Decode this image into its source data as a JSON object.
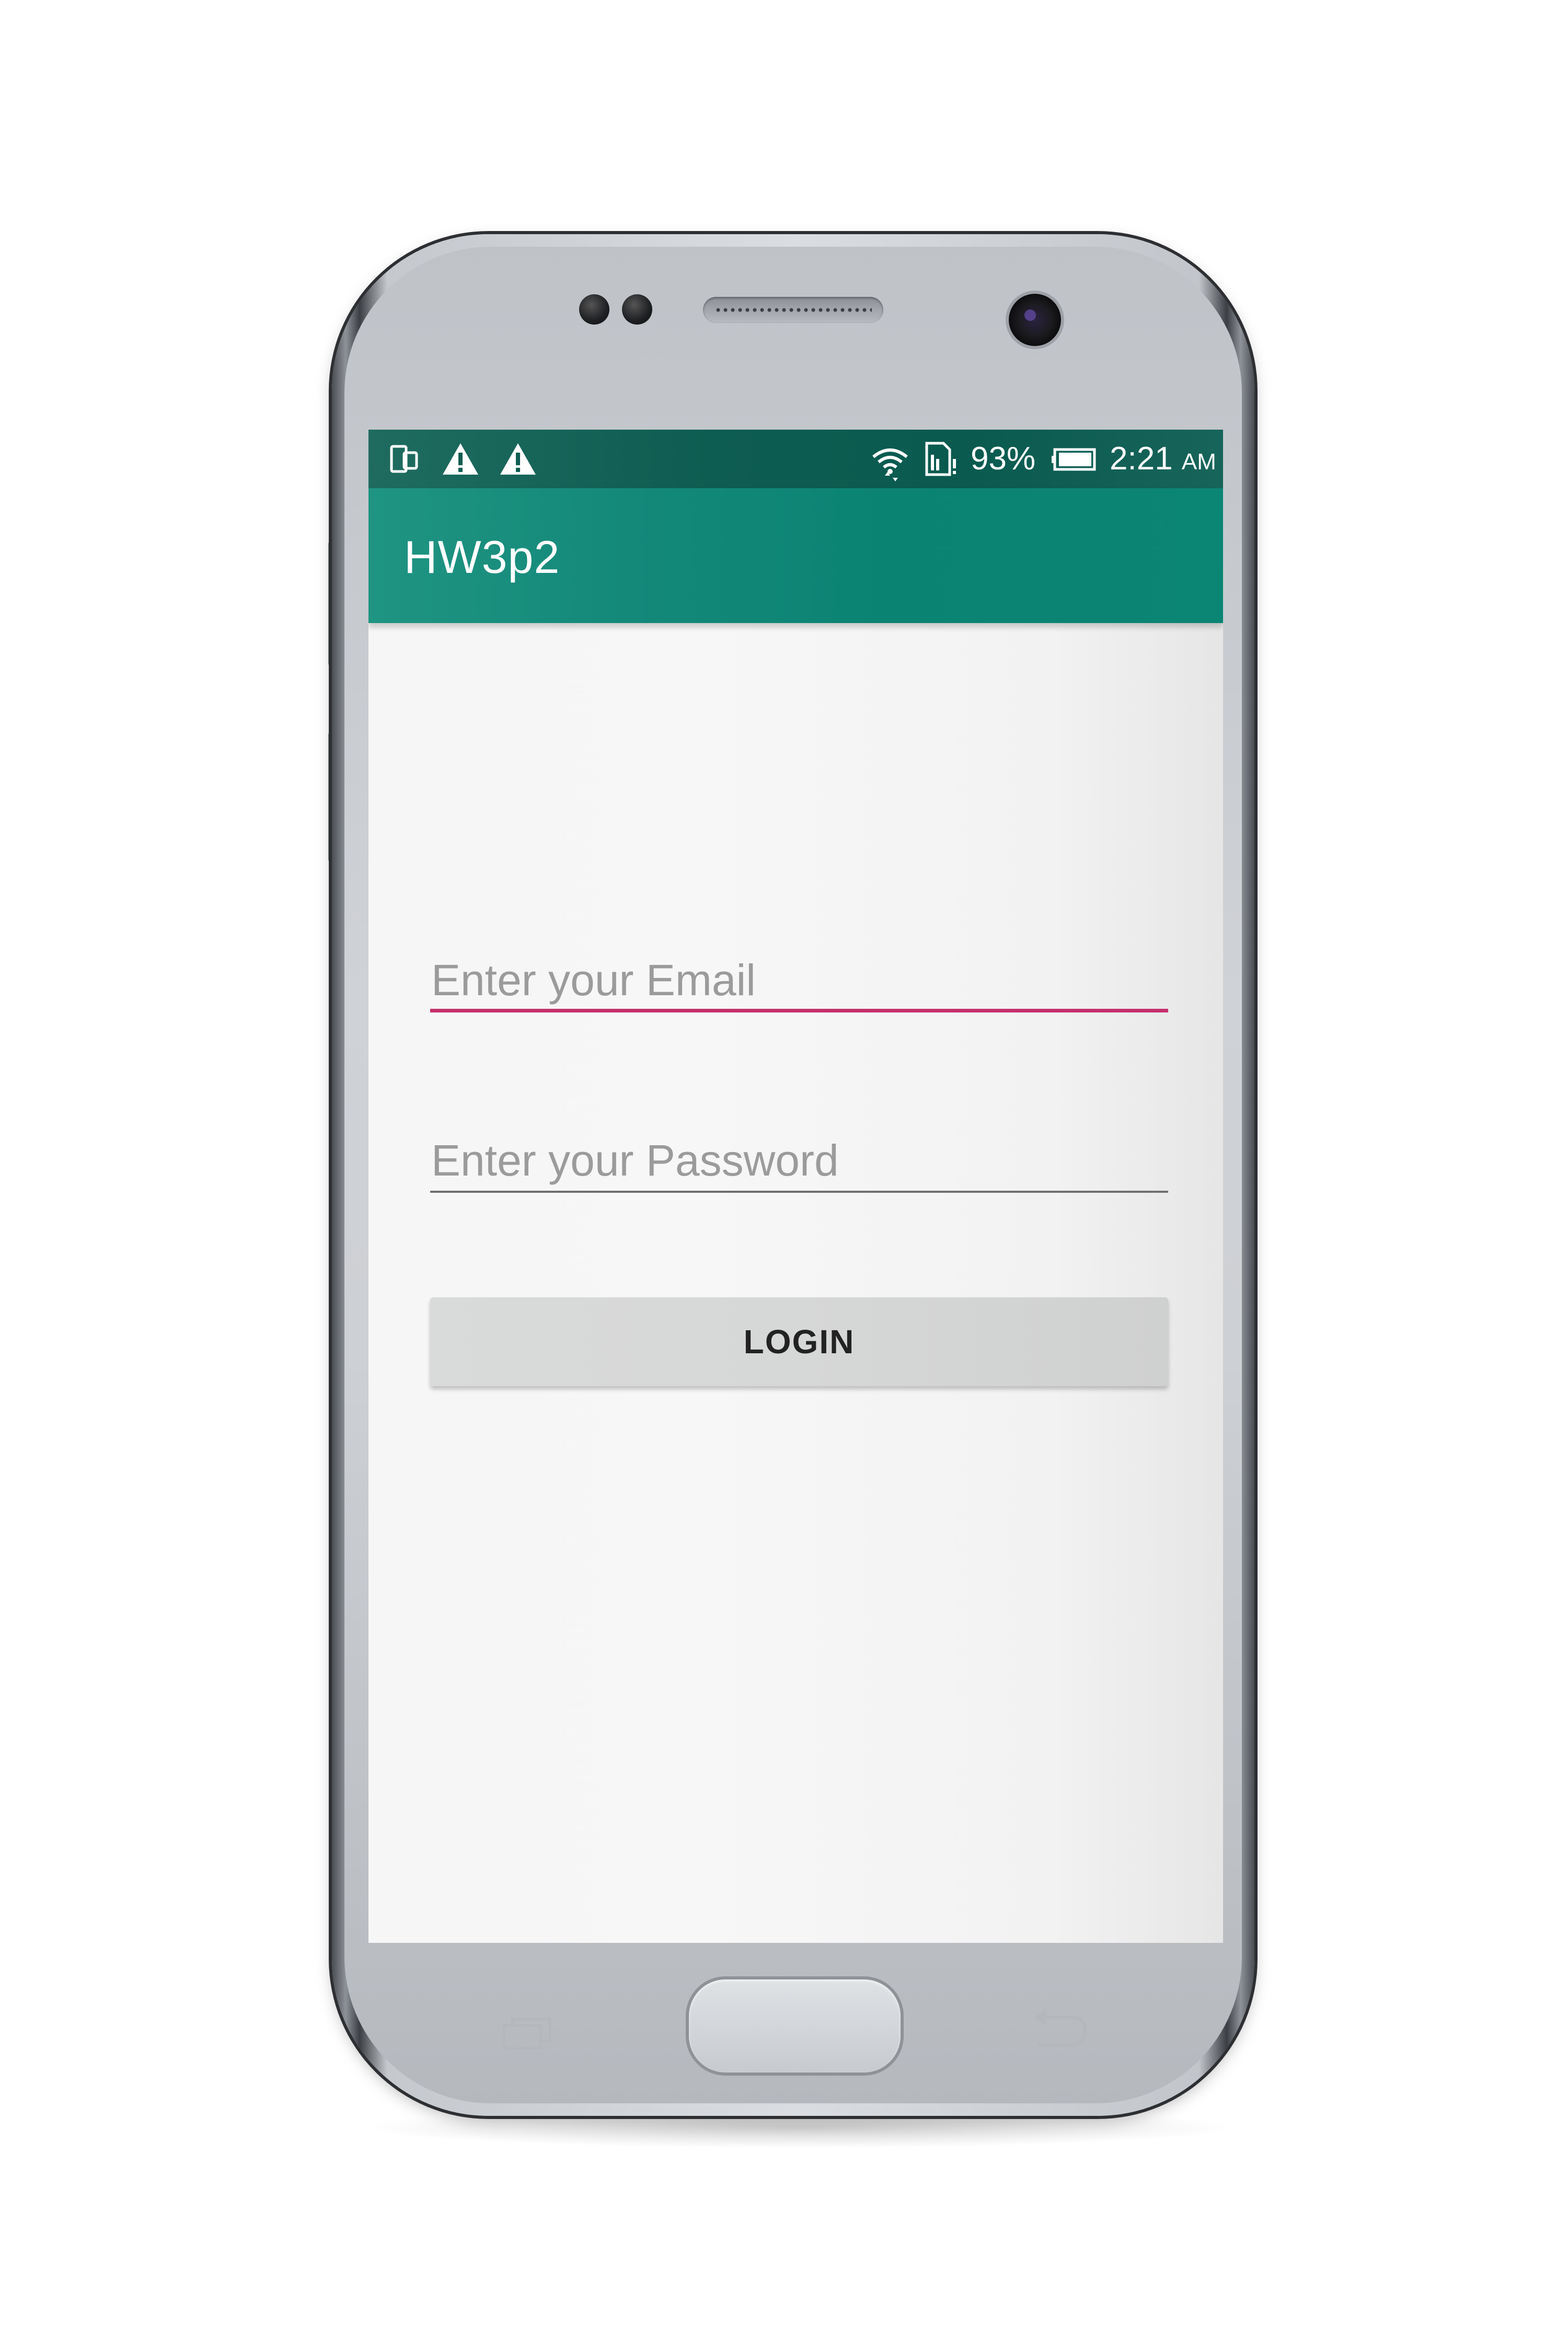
{
  "status_bar": {
    "icons": [
      "screen-rotate-icon",
      "warning-icon",
      "warning-icon",
      "wifi-icon",
      "sim-card-icon",
      "battery-icon"
    ],
    "battery_percent": "93%",
    "time": "2:21",
    "ampm": "AM"
  },
  "app_bar": {
    "title": "HW3p2"
  },
  "form": {
    "email_placeholder": "Enter your Email",
    "password_placeholder": "Enter your Password",
    "login_label": "LOGIN"
  },
  "colors": {
    "app_bar": "#0b8574",
    "status_bar": "#0a5a4f",
    "accent": "#c4306c"
  }
}
